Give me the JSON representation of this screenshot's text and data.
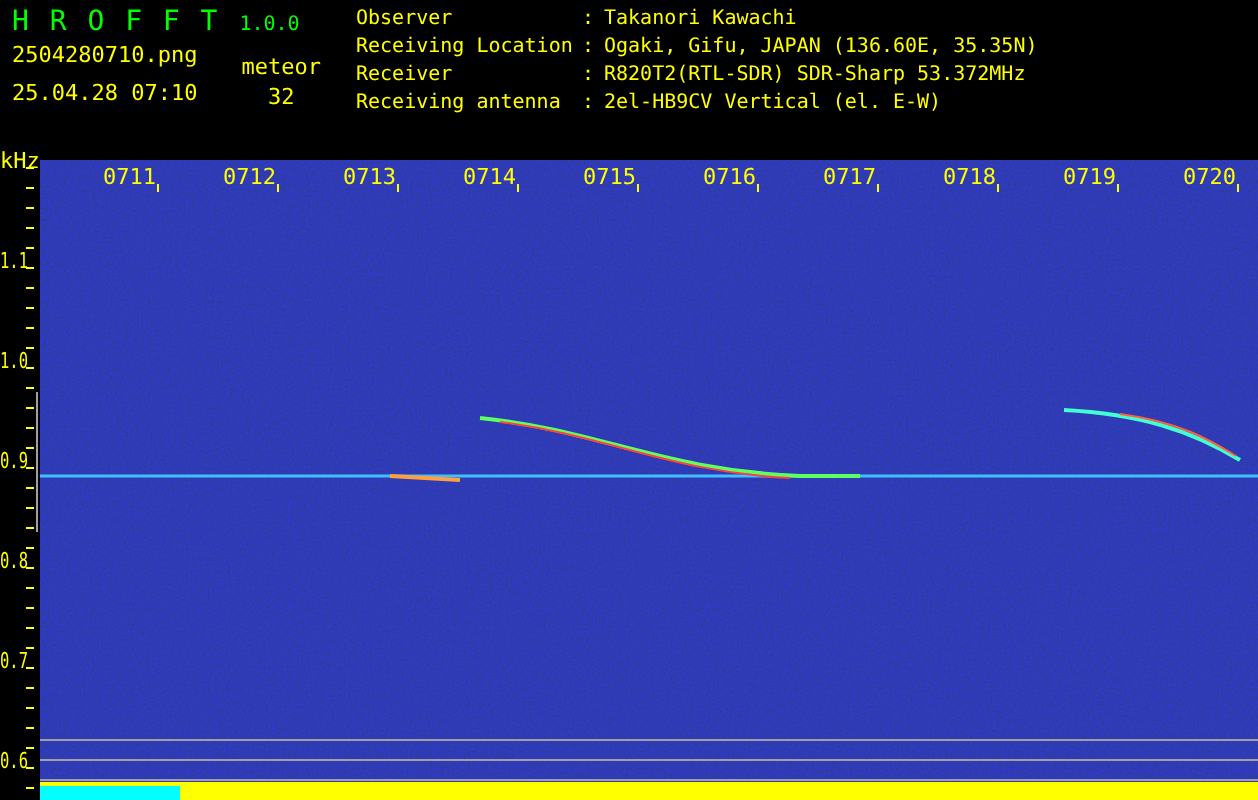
{
  "header": {
    "app_name": "H R O F F T",
    "version": "1.0.0",
    "filename": "2504280710.png",
    "datetime": "25.04.28 07:10",
    "meteor_label": "meteor",
    "meteor_count": "32",
    "info": [
      {
        "label": "Observer",
        "separator": ":",
        "value": "Takanori Kawachi"
      },
      {
        "label": "Receiving Location",
        "separator": ":",
        "value": "Ogaki, Gifu, JAPAN (136.60E, 35.35N)"
      },
      {
        "label": "Receiver",
        "separator": ":",
        "value": "R820T2(RTL-SDR) SDR-Sharp 53.372MHz"
      },
      {
        "label": "Receiving antenna",
        "separator": ":",
        "value": "2el-HB9CV Vertical (el. E-W)"
      }
    ]
  },
  "plot": {
    "y_unit": "kHz",
    "time_labels": [
      "0711",
      "0712",
      "0713",
      "0714",
      "0715",
      "0716",
      "0717",
      "0718",
      "0719",
      "0720"
    ],
    "freq_labels": [
      "1.1",
      "1.0",
      "0.9",
      "0.8",
      "0.7",
      "0.6"
    ]
  }
}
